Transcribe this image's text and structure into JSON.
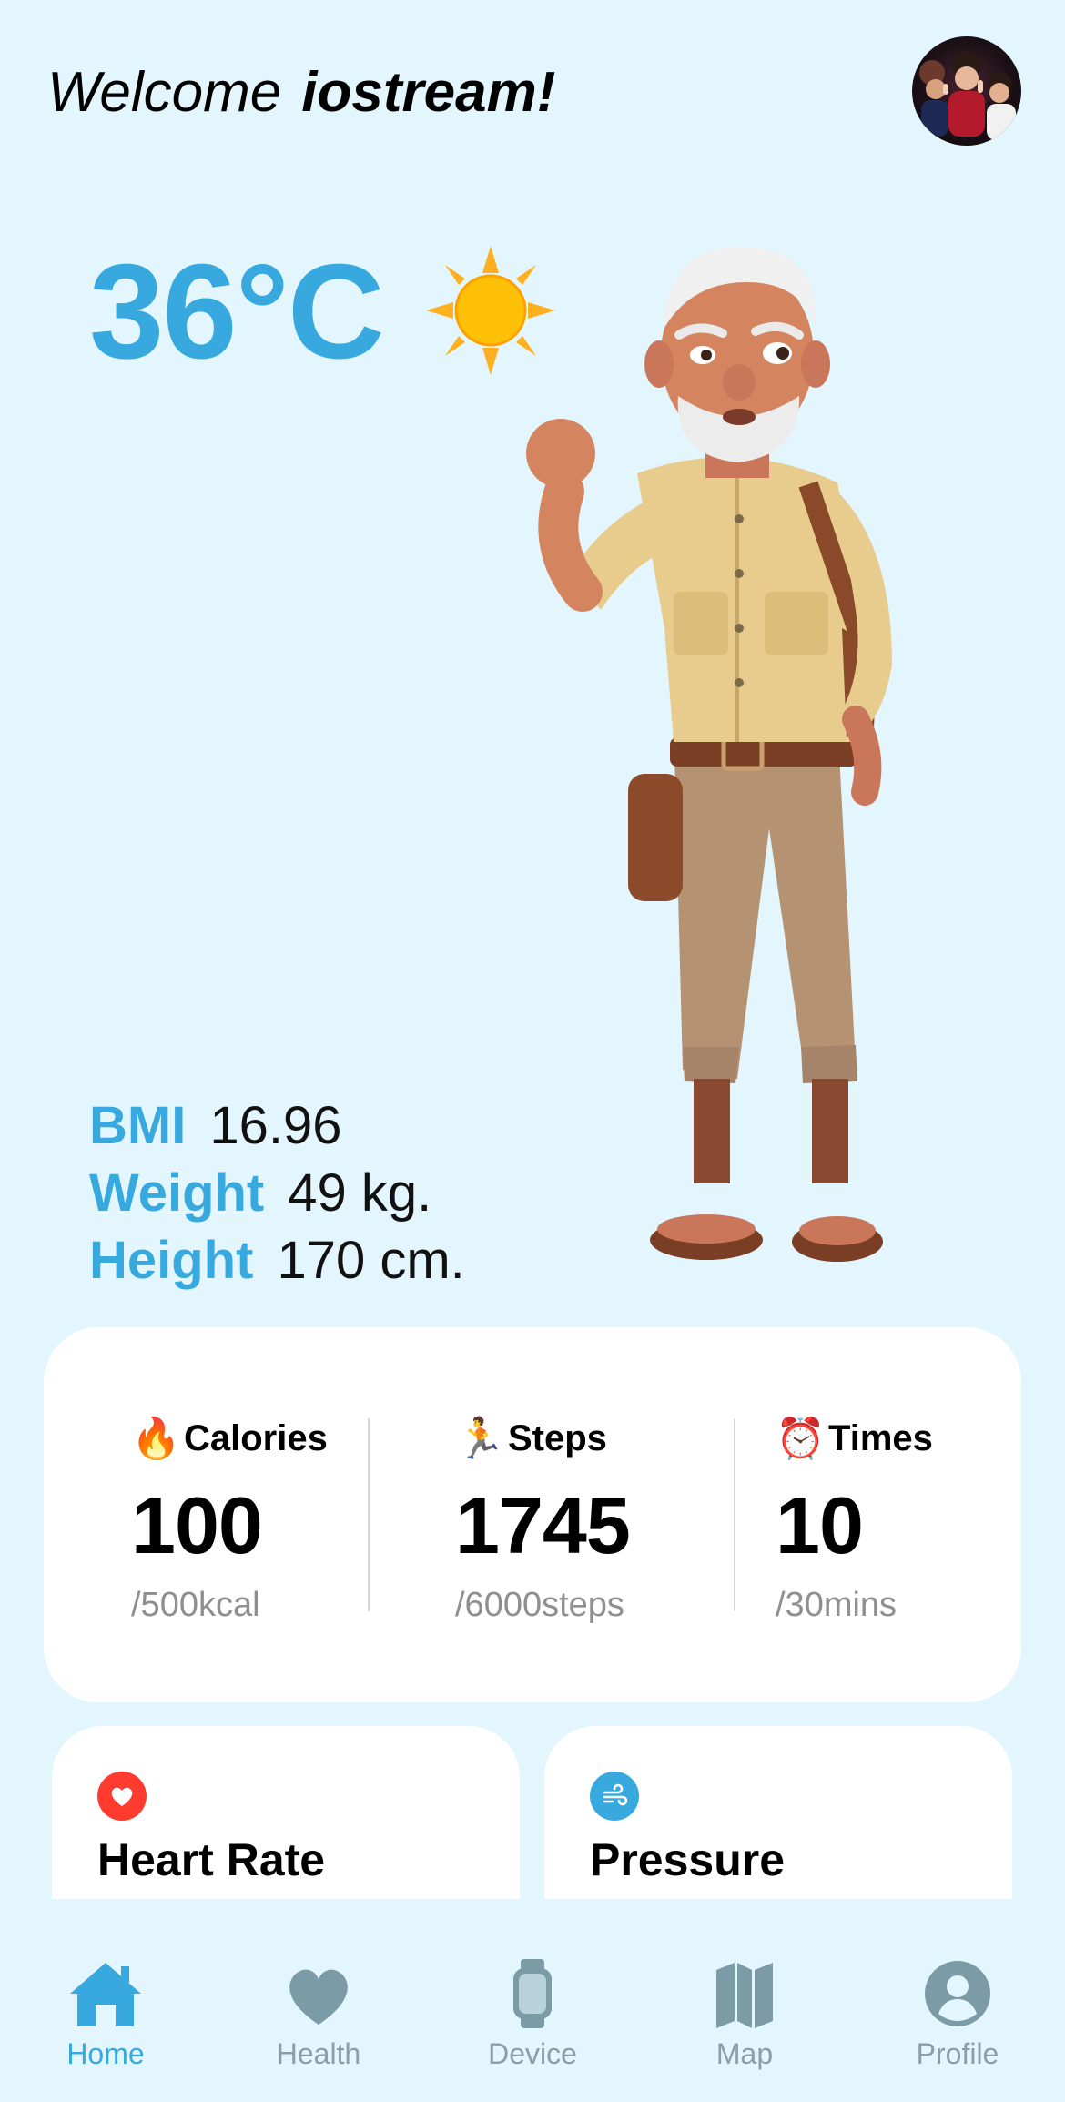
{
  "header": {
    "greeting": "Welcome",
    "username": "iostream!"
  },
  "weather": {
    "temperature": "36°C",
    "icon": "sun-icon"
  },
  "body_stats": [
    {
      "label": "BMI",
      "value": "16.96"
    },
    {
      "label": "Weight",
      "value": "49 kg."
    },
    {
      "label": "Height",
      "value": "170 cm."
    }
  ],
  "activity": [
    {
      "emoji": "🔥",
      "icon": "fire-icon",
      "label": "Calories",
      "value": "100",
      "goal": "/500kcal"
    },
    {
      "emoji": "🏃",
      "icon": "runner-icon",
      "label": "Steps",
      "value": "1745",
      "goal": "/6000steps"
    },
    {
      "emoji": "⏰",
      "icon": "alarm-clock-icon",
      "label": "Times",
      "value": "10",
      "goal": "/30mins"
    }
  ],
  "health_cards": [
    {
      "title": "Heart Rate",
      "icon": "heart-icon",
      "color": "#ff3b30"
    },
    {
      "title": "Pressure",
      "icon": "wind-icon",
      "color": "#38a9df"
    }
  ],
  "tabs": [
    {
      "label": "Home",
      "icon": "house-icon",
      "active": true
    },
    {
      "label": "Health",
      "icon": "heart-icon",
      "active": false
    },
    {
      "label": "Device",
      "icon": "watch-icon",
      "active": false
    },
    {
      "label": "Map",
      "icon": "map-icon",
      "active": false
    },
    {
      "label": "Profile",
      "icon": "person-circle-icon",
      "active": false
    }
  ],
  "colors": {
    "background": "#e3f6fd",
    "accent": "#38a9df",
    "inactive": "#8a9ea6",
    "card": "#ffffff"
  }
}
